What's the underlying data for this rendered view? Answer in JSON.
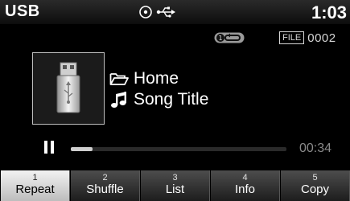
{
  "status": {
    "source": "USB",
    "clock": "1:03",
    "icons": [
      "disc-icon",
      "usb-icon"
    ]
  },
  "main": {
    "repeat_badge_icon": "repeat-one-icon",
    "file_label": "FILE",
    "file_number": "0002",
    "album_art_icon": "usb-drive-icon",
    "folder_icon": "folder-icon",
    "folder": "Home",
    "song_icon": "music-note-icon",
    "song_title": "Song Title",
    "playback_state_icon": "pause-icon",
    "progress_fraction": 0.1,
    "elapsed": "00:34"
  },
  "softkeys": [
    {
      "num": "1",
      "label": "Repeat",
      "active": true
    },
    {
      "num": "2",
      "label": "Shuffle",
      "active": false
    },
    {
      "num": "3",
      "label": "List",
      "active": false
    },
    {
      "num": "4",
      "label": "Info",
      "active": false
    },
    {
      "num": "5",
      "label": "Copy",
      "active": false
    }
  ],
  "colors": {
    "background": "#000000",
    "active_softkey": "#e6e6e6",
    "elapsed_text": "#8a8a8a"
  }
}
